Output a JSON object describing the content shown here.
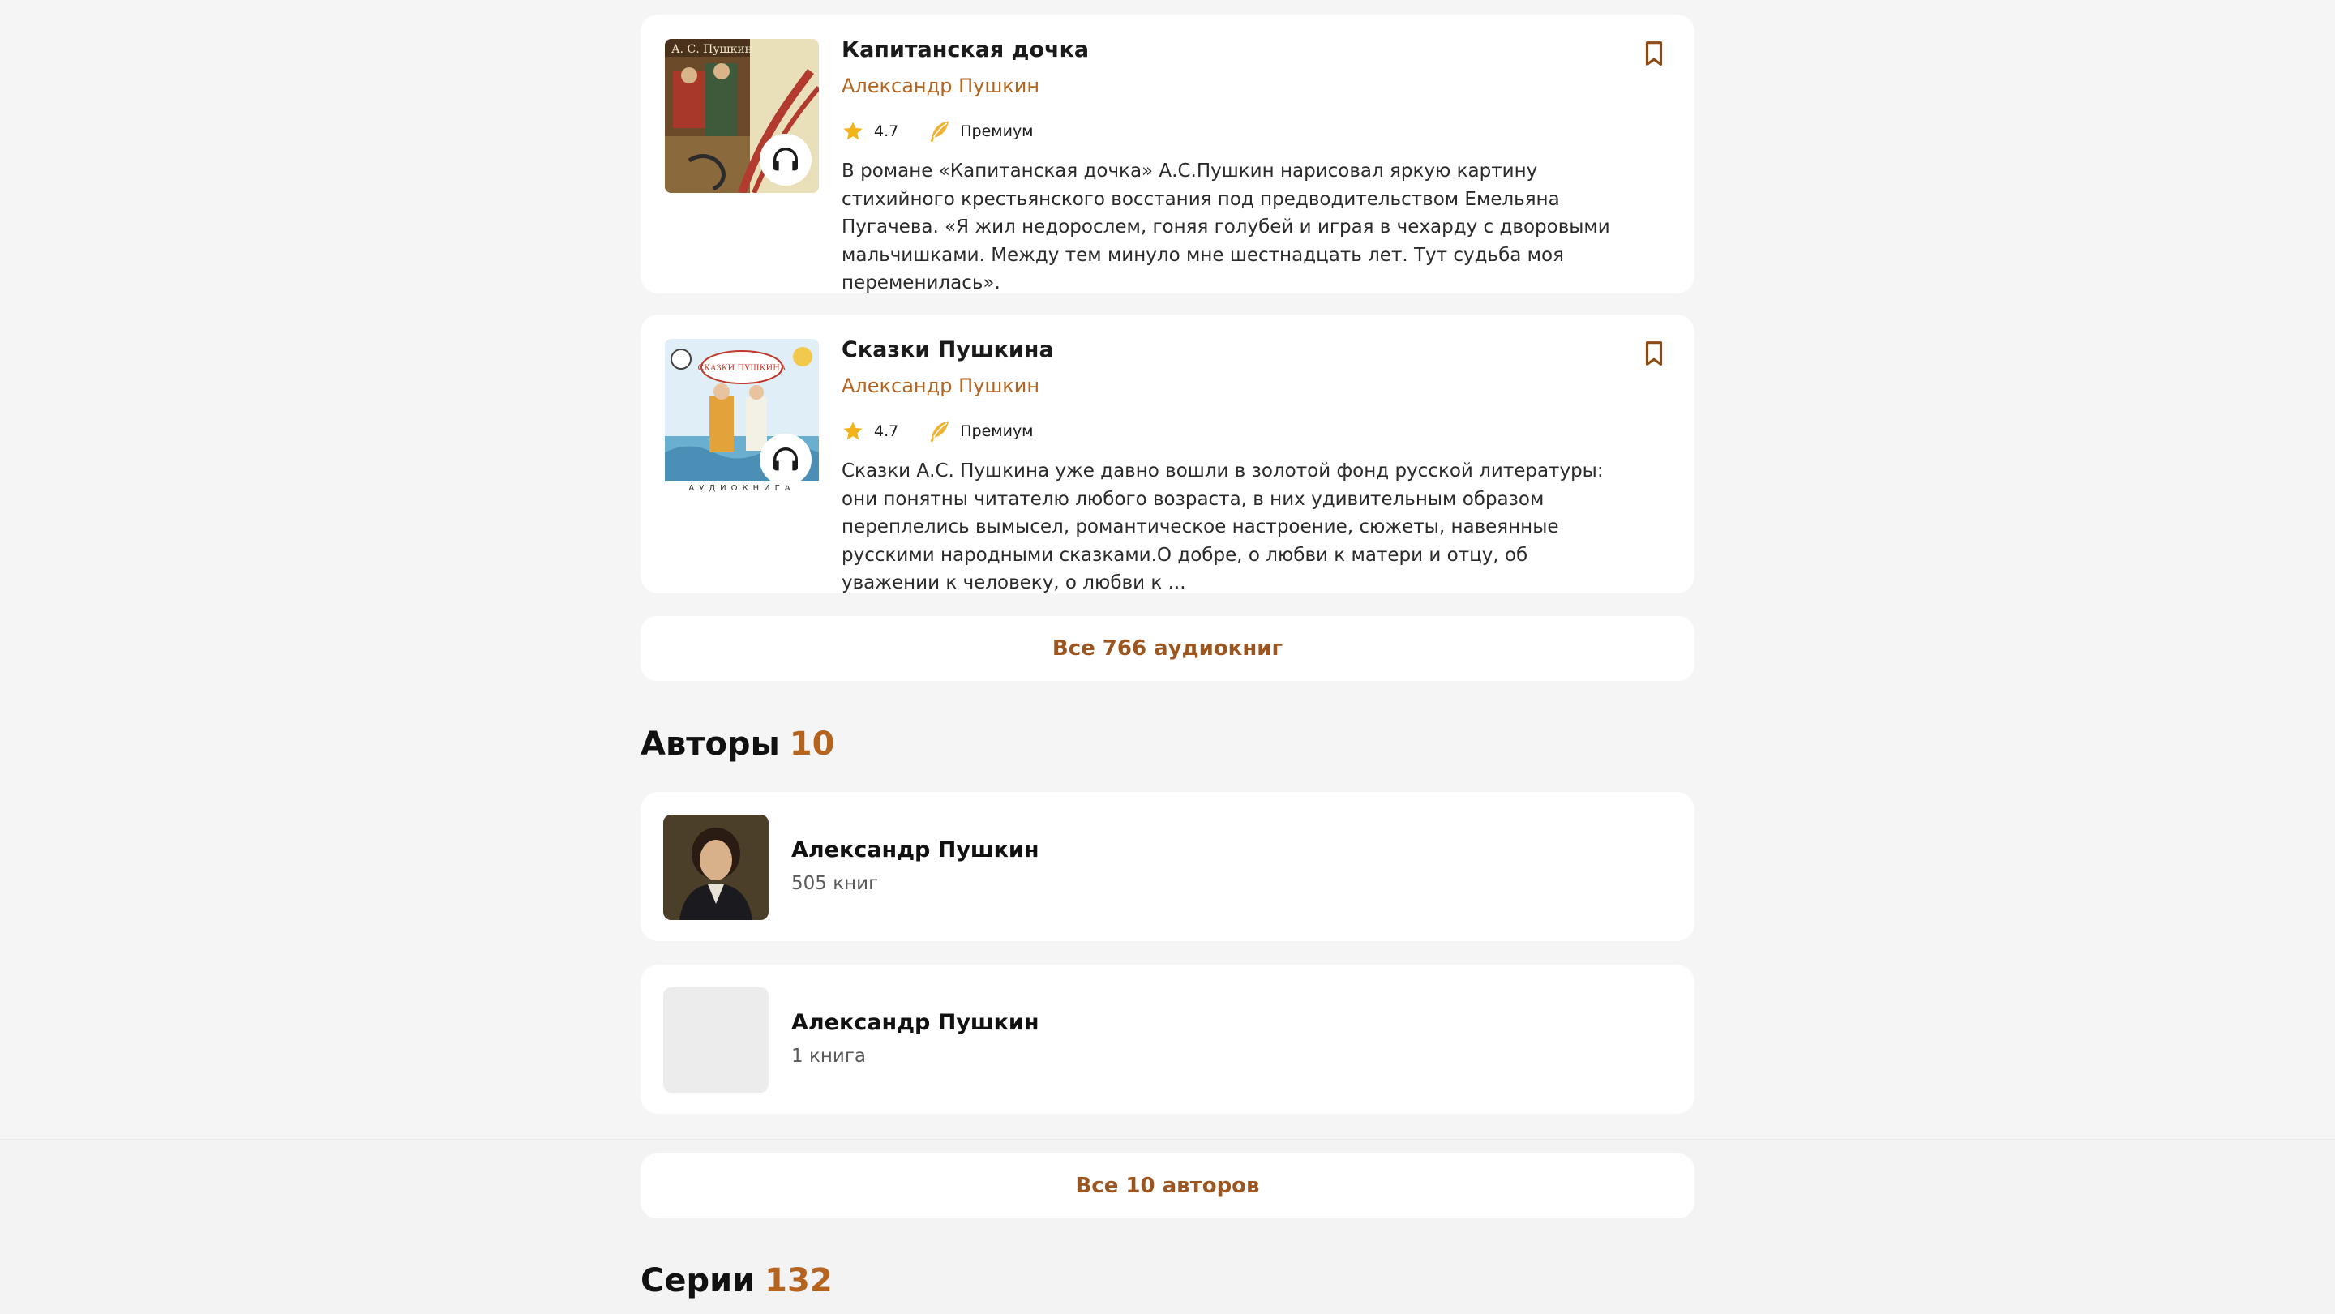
{
  "books": [
    {
      "title": "Капитанская дочка",
      "author": "Александр Пушкин",
      "rating": "4.7",
      "badge": "Премиум",
      "description": "В романе «Капитанская дочка» А.С.Пушкин нарисовал яркую картину стихийного крестьянского восстания под предводительством Емельяна Пугачева. «Я жил недорослем, гоняя голубей и играя в чехарду с дворовыми мальчишками. Между тем минуло мне шестнадцать лет. Тут судьба моя переменилась».",
      "cover_text": "А. С. Пушкин"
    },
    {
      "title": "Сказки Пушкина",
      "author": "Александр Пушкин",
      "rating": "4.7",
      "badge": "Премиум",
      "description": "Сказки А.С. Пушкина уже давно вошли в золотой фонд русской литературы: они понятны читателю любого возраста, в них удивительным образом переплелись вымысел, романтическое настроение, сюжеты, навеянные русскими народными сказками.О добре, о любви к матери и отцу, об уважении к человеку, о любви к ...",
      "cover_text": "СКАЗКИ ПУШКИНА",
      "cover_subtext": "АУДИОКНИГА"
    }
  ],
  "all_audiobooks_label": "Все 766 аудиокниг",
  "authors_section": {
    "title": "Авторы",
    "count": "10"
  },
  "authors": [
    {
      "name": "Александр Пушкин",
      "books": "505 книг"
    },
    {
      "name": "Александр Пушкин",
      "books": "1 книга"
    }
  ],
  "all_authors_label": "Все 10 авторов",
  "series_section": {
    "title": "Серии",
    "count": "132"
  },
  "icons": {
    "rating": "star-icon",
    "premium": "premium-feather-icon",
    "bookmark": "bookmark-icon",
    "listen": "headphones-icon"
  },
  "colors": {
    "accent": "#b5641f",
    "button_text": "#9a5520",
    "star": "#f2b418",
    "premium": "#f0b232",
    "bookmark": "#8a4a16",
    "background": "#f5f5f5"
  }
}
